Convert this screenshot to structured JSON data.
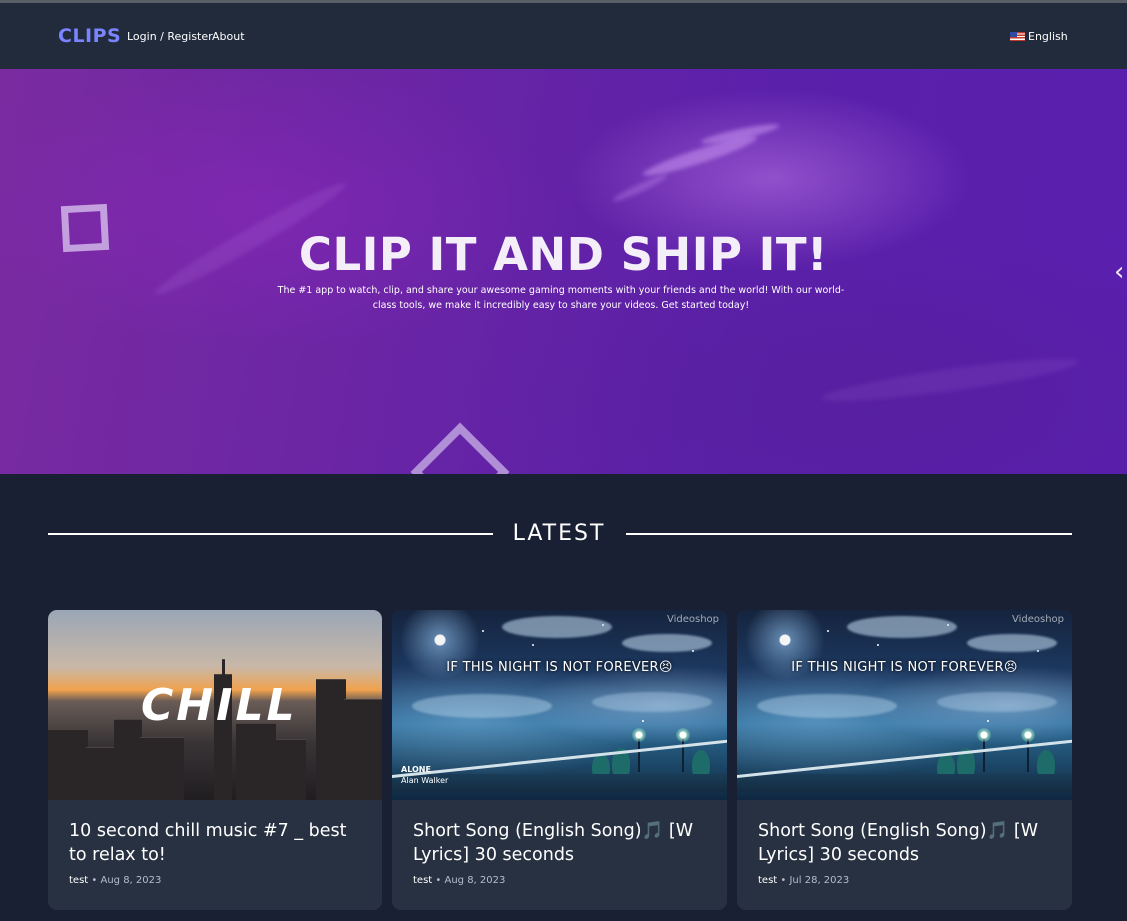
{
  "nav": {
    "brand": "CLIPS",
    "login_label": "Login / Register",
    "about_label": "About",
    "language": "English",
    "language_icon": "us-flag-icon"
  },
  "hero": {
    "title": "CLIP IT AND SHIP IT!",
    "subtitle": "The #1 app to watch, clip, and share your awesome gaming moments with your friends and the world! With our world-class tools, we make it incredibly easy to share your videos. Get started today!"
  },
  "section": {
    "title": "LATEST"
  },
  "clips": [
    {
      "title": "10 second chill music #7 _ best to relax to!",
      "user": "test",
      "date": "Aug 8, 2023",
      "thumb_text": "CHILL"
    },
    {
      "title": "Short Song (English Song)🎵 [W Lyrics] 30 seconds",
      "user": "test",
      "date": "Aug 8, 2023",
      "thumb_text": "IF THIS NIGHT IS NOT FOREVER😣",
      "thumb_watermark": "Videoshop",
      "thumb_artist_line1": "ALONE",
      "thumb_artist_line2": "Alan Walker"
    },
    {
      "title": "Short Song (English Song)🎵 [W Lyrics] 30 seconds",
      "user": "test",
      "date": "Jul 28, 2023",
      "thumb_text": "IF THIS NIGHT IS NOT FOREVER😣",
      "thumb_watermark": "Videoshop"
    }
  ],
  "colors": {
    "brand": "#7b84ff",
    "navbar": "#222b3c",
    "page_bg": "#1a2033",
    "card_bg": "#283141",
    "hero_purple": "#6a25a5"
  }
}
